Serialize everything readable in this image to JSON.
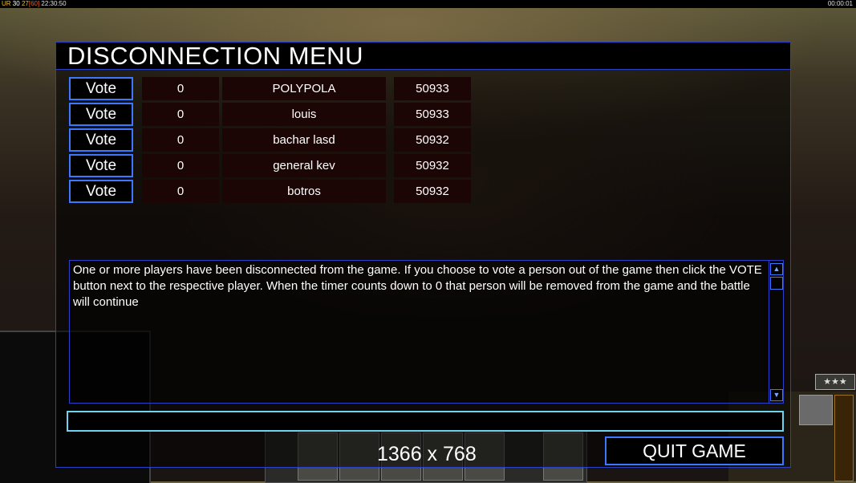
{
  "hud": {
    "left_segments": [
      "UR",
      "30",
      "27",
      "[60]",
      "22:30:50"
    ],
    "right_clock": "00:00:01",
    "stars": "★★★",
    "resolution_label": "1366 x 768"
  },
  "dialog": {
    "title": "DISCONNECTION MENU",
    "vote_label": "Vote",
    "players": [
      {
        "votes": "0",
        "name": "POLYPOLA",
        "ping": "50933"
      },
      {
        "votes": "0",
        "name": "louis",
        "ping": "50933"
      },
      {
        "votes": "0",
        "name": "bachar lasd",
        "ping": "50932"
      },
      {
        "votes": "0",
        "name": "general kev",
        "ping": "50932"
      },
      {
        "votes": "0",
        "name": "botros",
        "ping": "50932"
      }
    ],
    "message": "One or more players have been disconnected from the game. If you choose to vote a person out of the game then click the VOTE button next to the respective player. When the timer counts down to 0 that person will be removed from the game and the battle will continue",
    "chat_value": "",
    "quit_label": "QUIT GAME"
  },
  "icons": {
    "scroll_up": "scroll-up-arrow-icon",
    "scroll_down": "scroll-down-arrow-icon",
    "stars": "rank-stars-icon"
  }
}
